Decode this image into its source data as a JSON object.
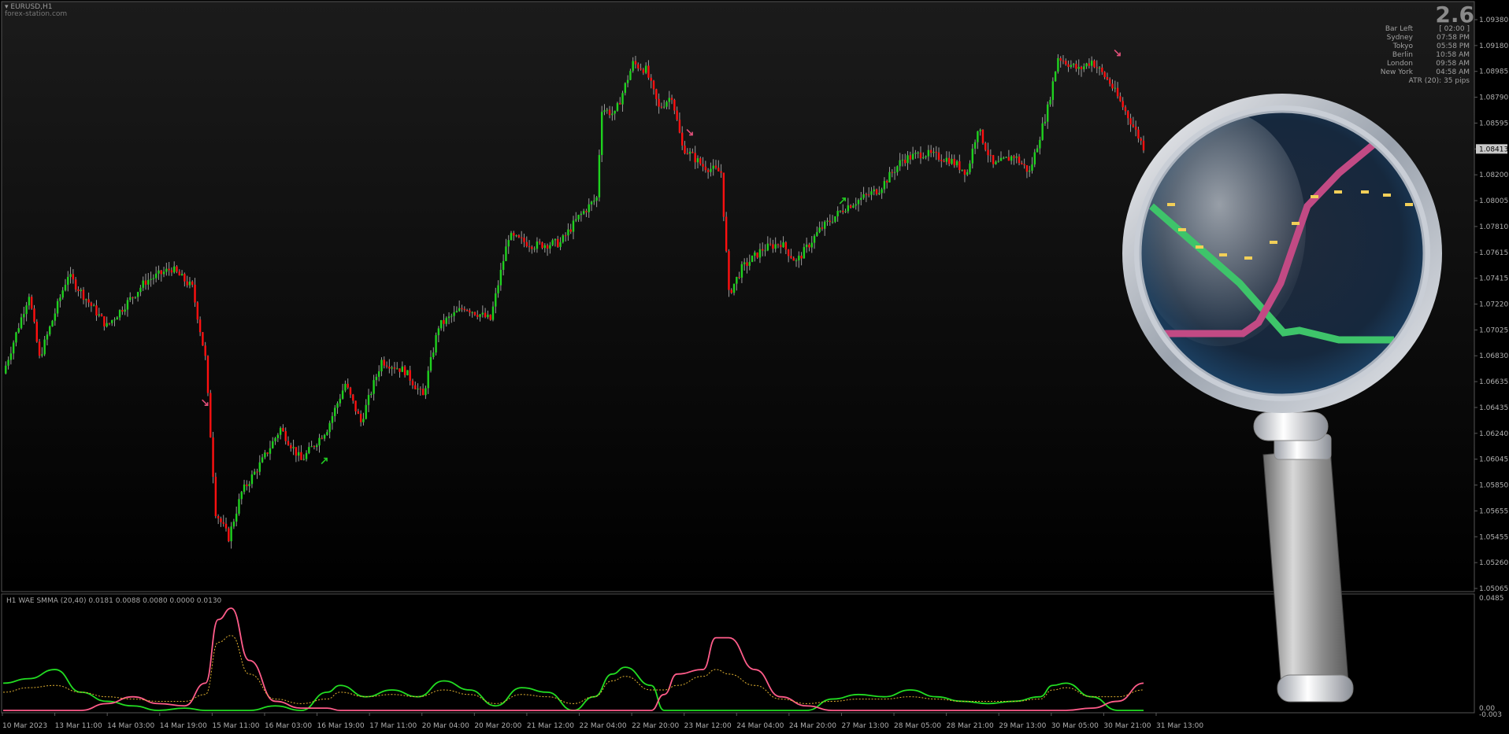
{
  "symbol": "EURUSD,H1",
  "watermark": "forex-station.com",
  "corner_value": "2.6",
  "info_panel": [
    {
      "label": "Bar Left",
      "value": "[ 02:00 ]"
    },
    {
      "label": "Sydney",
      "value": "07:58 PM"
    },
    {
      "label": "Tokyo",
      "value": "05:58 PM"
    },
    {
      "label": "Berlin",
      "value": "10:58 AM"
    },
    {
      "label": "London",
      "value": "09:58 AM"
    },
    {
      "label": "New York",
      "value": "04:58 AM"
    },
    {
      "label": "",
      "value": "ATR (20): 35 pips"
    }
  ],
  "indicator_label": "H1  WAE  SMMA (20,40) 0.0181 0.0088 0.0080 0.0000 0.0130",
  "colors": {
    "background": "#000000",
    "bull": "#1fd11f",
    "bear": "#ff1010",
    "wick": "#9a9a9a",
    "arrow_up": "#22cc22",
    "arrow_down": "#e0507a",
    "ind_green": "#22dd22",
    "ind_pink": "#ff5c8a",
    "ind_dots": "#e0b030",
    "grid": "#5a5a5a",
    "axis_text": "#b0b0b0"
  },
  "chart_data": [
    {
      "type": "candlestick",
      "title": "EURUSD,H1",
      "xlabel": "",
      "ylabel": "",
      "x_tick_labels": [
        "10 Mar 2023",
        "13 Mar 11:00",
        "14 Mar 03:00",
        "14 Mar 19:00",
        "15 Mar 11:00",
        "16 Mar 03:00",
        "16 Mar 19:00",
        "17 Mar 11:00",
        "20 Mar 04:00",
        "20 Mar 20:00",
        "21 Mar 12:00",
        "22 Mar 04:00",
        "22 Mar 20:00",
        "23 Mar 12:00",
        "24 Mar 04:00",
        "24 Mar 20:00",
        "27 Mar 13:00",
        "28 Mar 05:00",
        "28 Mar 21:00",
        "29 Mar 13:00",
        "30 Mar 05:00",
        "30 Mar 21:00",
        "31 Mar 13:00"
      ],
      "y_tick_labels": [
        "1.09380",
        "1.09180",
        "1.08985",
        "1.08790",
        "1.08595",
        "1.08413",
        "1.08200",
        "1.08005",
        "1.07810",
        "1.07615",
        "1.07415",
        "1.07220",
        "1.07025",
        "1.06830",
        "1.06635",
        "1.06435",
        "1.06240",
        "1.06045",
        "1.05850",
        "1.05655",
        "1.05455",
        "1.05260",
        "1.05065"
      ],
      "current_price": "1.08413",
      "ylim": [
        1.0499,
        1.0946
      ],
      "path_points": [
        {
          "bar": 0,
          "price": 1.0668
        },
        {
          "bar": 10,
          "price": 1.073
        },
        {
          "bar": 14,
          "price": 1.068
        },
        {
          "bar": 25,
          "price": 1.0745
        },
        {
          "bar": 40,
          "price": 1.0705
        },
        {
          "bar": 55,
          "price": 1.074
        },
        {
          "bar": 65,
          "price": 1.075
        },
        {
          "bar": 73,
          "price": 1.0735
        },
        {
          "bar": 78,
          "price": 1.068
        },
        {
          "bar": 82,
          "price": 1.056
        },
        {
          "bar": 87,
          "price": 1.054
        },
        {
          "bar": 92,
          "price": 1.0575
        },
        {
          "bar": 100,
          "price": 1.06
        },
        {
          "bar": 107,
          "price": 1.0625
        },
        {
          "bar": 115,
          "price": 1.06
        },
        {
          "bar": 125,
          "price": 1.0625
        },
        {
          "bar": 132,
          "price": 1.066
        },
        {
          "bar": 138,
          "price": 1.063
        },
        {
          "bar": 146,
          "price": 1.0678
        },
        {
          "bar": 155,
          "price": 1.067
        },
        {
          "bar": 162,
          "price": 1.065
        },
        {
          "bar": 168,
          "price": 1.0705
        },
        {
          "bar": 178,
          "price": 1.072
        },
        {
          "bar": 188,
          "price": 1.071
        },
        {
          "bar": 195,
          "price": 1.0775
        },
        {
          "bar": 205,
          "price": 1.0768
        },
        {
          "bar": 215,
          "price": 1.077
        },
        {
          "bar": 222,
          "price": 1.079
        },
        {
          "bar": 229,
          "price": 1.0805
        },
        {
          "bar": 231,
          "price": 1.0875
        },
        {
          "bar": 236,
          "price": 1.087
        },
        {
          "bar": 243,
          "price": 1.091
        },
        {
          "bar": 248,
          "price": 1.0905
        },
        {
          "bar": 253,
          "price": 1.0875
        },
        {
          "bar": 258,
          "price": 1.0885
        },
        {
          "bar": 262,
          "price": 1.0845
        },
        {
          "bar": 270,
          "price": 1.083
        },
        {
          "bar": 277,
          "price": 1.0825
        },
        {
          "bar": 280,
          "price": 1.073
        },
        {
          "bar": 285,
          "price": 1.075
        },
        {
          "bar": 293,
          "price": 1.0765
        },
        {
          "bar": 300,
          "price": 1.077
        },
        {
          "bar": 306,
          "price": 1.0755
        },
        {
          "bar": 315,
          "price": 1.078
        },
        {
          "bar": 325,
          "price": 1.0798
        },
        {
          "bar": 338,
          "price": 1.0812
        },
        {
          "bar": 347,
          "price": 1.0835
        },
        {
          "bar": 355,
          "price": 1.084
        },
        {
          "bar": 365,
          "price": 1.0835
        },
        {
          "bar": 372,
          "price": 1.0825
        },
        {
          "bar": 376,
          "price": 1.086
        },
        {
          "bar": 382,
          "price": 1.083
        },
        {
          "bar": 390,
          "price": 1.0838
        },
        {
          "bar": 396,
          "price": 1.0825
        },
        {
          "bar": 403,
          "price": 1.0875
        },
        {
          "bar": 407,
          "price": 1.0915
        },
        {
          "bar": 415,
          "price": 1.0905
        },
        {
          "bar": 420,
          "price": 1.0912
        },
        {
          "bar": 427,
          "price": 1.0895
        },
        {
          "bar": 435,
          "price": 1.0865
        },
        {
          "bar": 440,
          "price": 1.0845
        }
      ],
      "arrows": [
        {
          "bar": 78,
          "price": 1.0645,
          "dir": "down"
        },
        {
          "bar": 124,
          "price": 1.06,
          "dir": "up"
        },
        {
          "bar": 265,
          "price": 1.0856,
          "dir": "down"
        },
        {
          "bar": 324,
          "price": 1.0803,
          "dir": "up"
        },
        {
          "bar": 430,
          "price": 1.0918,
          "dir": "down"
        }
      ]
    },
    {
      "type": "line",
      "title": "H1  WAE  SMMA (20,40) 0.0181 0.0088 0.0080 0.0000 0.0130",
      "y_tick_labels": [
        "0.0485",
        "0.00",
        "-0.003"
      ],
      "ylim": [
        0,
        0.0485
      ],
      "x_bars": [
        0,
        10,
        20,
        30,
        40,
        50,
        60,
        70,
        78,
        83,
        88,
        95,
        105,
        115,
        125,
        130,
        140,
        150,
        160,
        170,
        180,
        190,
        200,
        210,
        220,
        228,
        235,
        240,
        250,
        255,
        260,
        270,
        275,
        280,
        290,
        300,
        310,
        320,
        330,
        340,
        350,
        360,
        370,
        380,
        390,
        400,
        405,
        410,
        420,
        430,
        440
      ],
      "series": [
        {
          "name": "",
          "style": "green",
          "values": [
            0.012,
            0.014,
            0.018,
            0.008,
            0.004,
            0.002,
            0.0,
            0.001,
            0.0,
            0.0,
            0.0,
            0.0,
            0.002,
            0.0,
            0.008,
            0.011,
            0.006,
            0.009,
            0.006,
            0.013,
            0.009,
            0.002,
            0.01,
            0.008,
            0.0,
            0.006,
            0.016,
            0.019,
            0.011,
            0.0,
            0.0,
            0.0,
            0.0,
            0.0,
            0.0,
            0.0,
            0.0,
            0.005,
            0.007,
            0.006,
            0.009,
            0.006,
            0.004,
            0.003,
            0.004,
            0.006,
            0.011,
            0.012,
            0.006,
            0.0,
            0.0
          ]
        },
        {
          "name": "",
          "style": "pink",
          "values": [
            0.0,
            0.0,
            0.0,
            0.0,
            0.003,
            0.006,
            0.003,
            0.002,
            0.012,
            0.04,
            0.045,
            0.022,
            0.004,
            0.001,
            0.001,
            0.0,
            0.0,
            0.0,
            0.0,
            0.0,
            0.0,
            0.0,
            0.0,
            0.0,
            0.0,
            0.0,
            0.0,
            0.0,
            0.0,
            0.007,
            0.016,
            0.018,
            0.032,
            0.032,
            0.018,
            0.006,
            0.002,
            0.0,
            0.0,
            0.0,
            0.0,
            0.0,
            0.0,
            0.0,
            0.0,
            0.0,
            0.0,
            0.0,
            0.001,
            0.004,
            0.012
          ]
        },
        {
          "name": "",
          "style": "dots",
          "values": [
            0.008,
            0.01,
            0.011,
            0.008,
            0.006,
            0.005,
            0.004,
            0.004,
            0.007,
            0.03,
            0.033,
            0.016,
            0.005,
            0.003,
            0.005,
            0.008,
            0.006,
            0.007,
            0.006,
            0.009,
            0.007,
            0.003,
            0.007,
            0.006,
            0.003,
            0.006,
            0.013,
            0.015,
            0.009,
            0.009,
            0.011,
            0.015,
            0.018,
            0.016,
            0.011,
            0.005,
            0.003,
            0.004,
            0.005,
            0.005,
            0.006,
            0.005,
            0.004,
            0.004,
            0.004,
            0.005,
            0.009,
            0.01,
            0.006,
            0.006,
            0.009
          ]
        }
      ]
    }
  ]
}
